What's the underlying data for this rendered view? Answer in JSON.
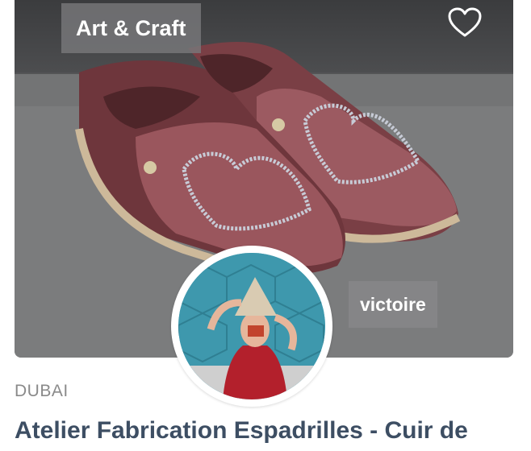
{
  "card": {
    "category": "Art & Craft",
    "host_name": "victoire",
    "location": "DUBAI",
    "title": "Atelier Fabrication Espadrilles - Cuir de",
    "favorite_icon": "heart-outline-icon"
  },
  "colors": {
    "title": "#3d4e63",
    "location": "#8a8a8a",
    "badge_bg": "#78787a"
  }
}
